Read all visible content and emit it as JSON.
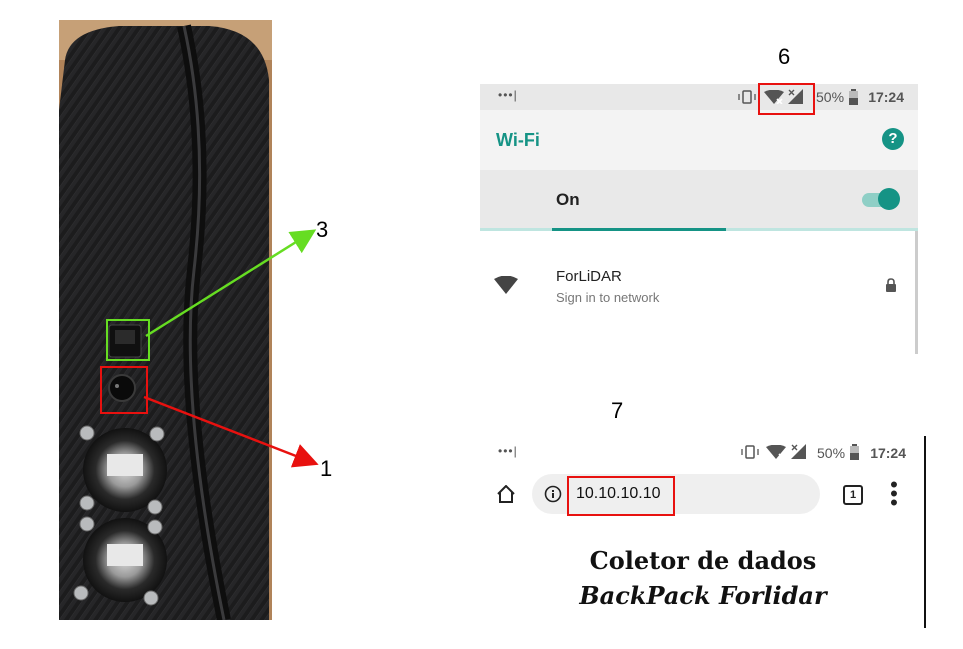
{
  "colors": {
    "accent_teal": "#159385",
    "callout_red": "#e8110f",
    "callout_green": "#66dd22"
  },
  "photo": {
    "callouts": [
      {
        "number": "3",
        "color": "green"
      },
      {
        "number": "1",
        "color": "red"
      }
    ]
  },
  "wifi_screen": {
    "step_number": "6",
    "status_bar": {
      "battery": "50%",
      "time": "17:24"
    },
    "title": "Wi-Fi",
    "help_icon": "question-icon",
    "toggle_label": "On",
    "toggle_state": "on",
    "network": {
      "name": "ForLiDAR",
      "subtitle": "Sign in to network",
      "secured": true
    }
  },
  "browser_screen": {
    "step_number": "7",
    "status_bar": {
      "battery": "50%",
      "time": "17:24"
    },
    "url": "10.10.10.10",
    "tab_count": "1",
    "heading_line1": "Coletor de dados",
    "heading_line2": "BackPack Forlidar"
  }
}
